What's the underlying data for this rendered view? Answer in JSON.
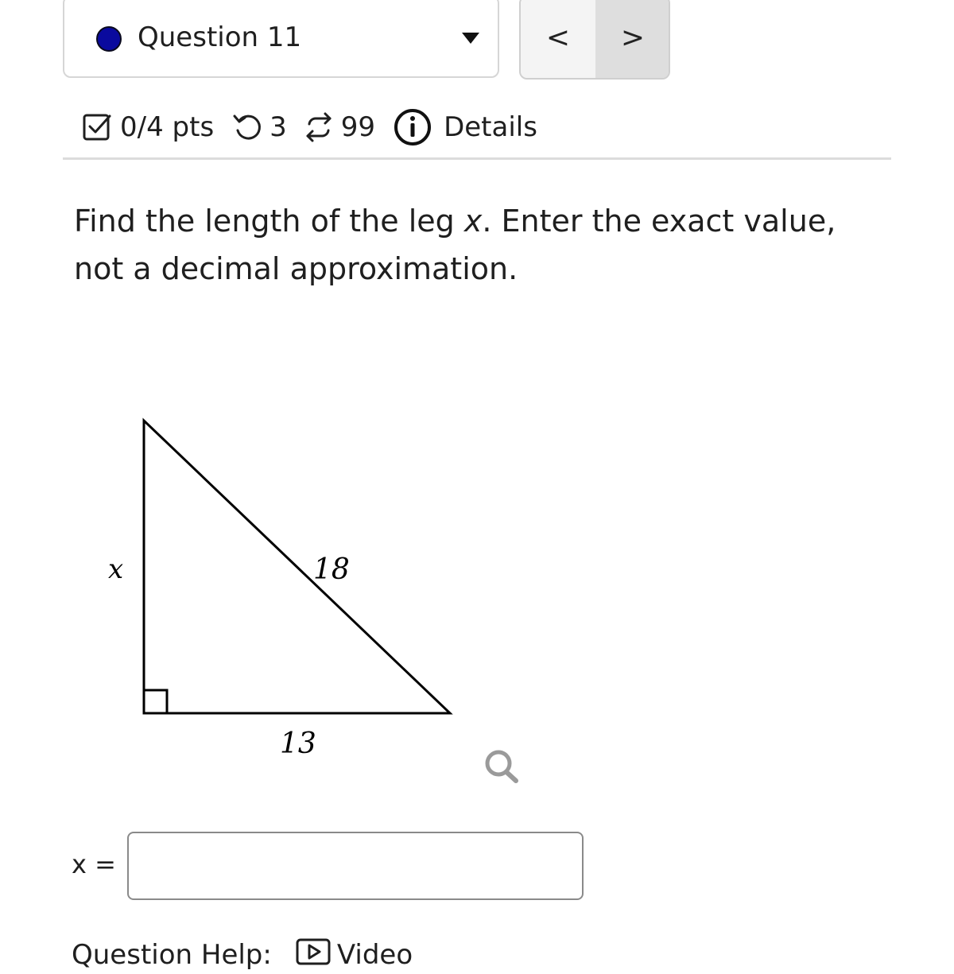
{
  "question_selector": {
    "label": "Question 11",
    "status_color": "#0a0a9e"
  },
  "nav": {
    "prev_glyph": "<",
    "next_glyph": ">"
  },
  "meta": {
    "points": "0/4 pts",
    "attempts": "3",
    "versions": "99",
    "details": "Details"
  },
  "prompt": {
    "before": "Find the length of the leg ",
    "variable": "x",
    "after": ". Enter the exact value, not a decimal approximation."
  },
  "figure": {
    "leg_label": "x",
    "hypotenuse_label": "18",
    "base_label": "13"
  },
  "answer": {
    "label": "x =",
    "value": ""
  },
  "help": {
    "label": "Question Help:",
    "video": "Video"
  },
  "icons": {
    "status": "status-dot-icon",
    "dropdown": "caret-down-icon",
    "points": "checkbox-icon",
    "attempts": "retry-icon",
    "versions": "swap-icon",
    "details": "info-icon",
    "zoom": "magnifier-icon",
    "video": "video-icon"
  }
}
